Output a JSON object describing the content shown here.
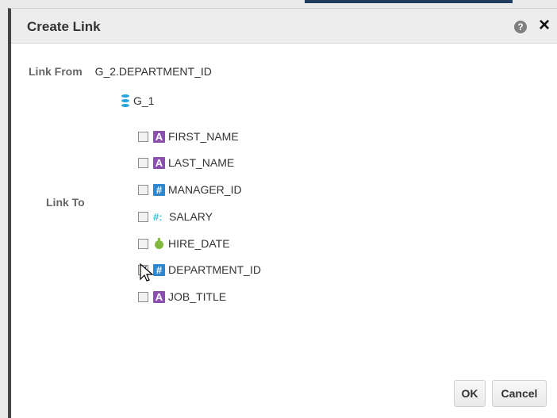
{
  "dialog": {
    "title": "Create Link"
  },
  "link_from": {
    "label": "Link From",
    "value": "G_2.DEPARTMENT_ID"
  },
  "link_to": {
    "label": "Link To"
  },
  "tree": {
    "root_label": "G_1",
    "items": [
      {
        "label": "FIRST_NAME",
        "icon": "string-icon",
        "checked": false
      },
      {
        "label": "LAST_NAME",
        "icon": "string-icon",
        "checked": false
      },
      {
        "label": "MANAGER_ID",
        "icon": "number-icon",
        "checked": false
      },
      {
        "label": "SALARY",
        "icon": "numeric-measure-icon",
        "checked": false
      },
      {
        "label": "HIRE_DATE",
        "icon": "date-icon",
        "checked": false
      },
      {
        "label": "DEPARTMENT_ID",
        "icon": "number-icon",
        "checked": true
      },
      {
        "label": "JOB_TITLE",
        "icon": "string-icon",
        "checked": false
      }
    ]
  },
  "buttons": {
    "ok": "OK",
    "cancel": "Cancel"
  },
  "icons": {
    "help": "?",
    "close": "×",
    "string": "A",
    "number": "#",
    "measure": "#:"
  },
  "colors": {
    "accent": "#1f3b5d",
    "database": "#28a3dd",
    "string_icon": "#8b4fb0",
    "number_icon": "#2f87cf",
    "date_icon": "#83b83f"
  }
}
